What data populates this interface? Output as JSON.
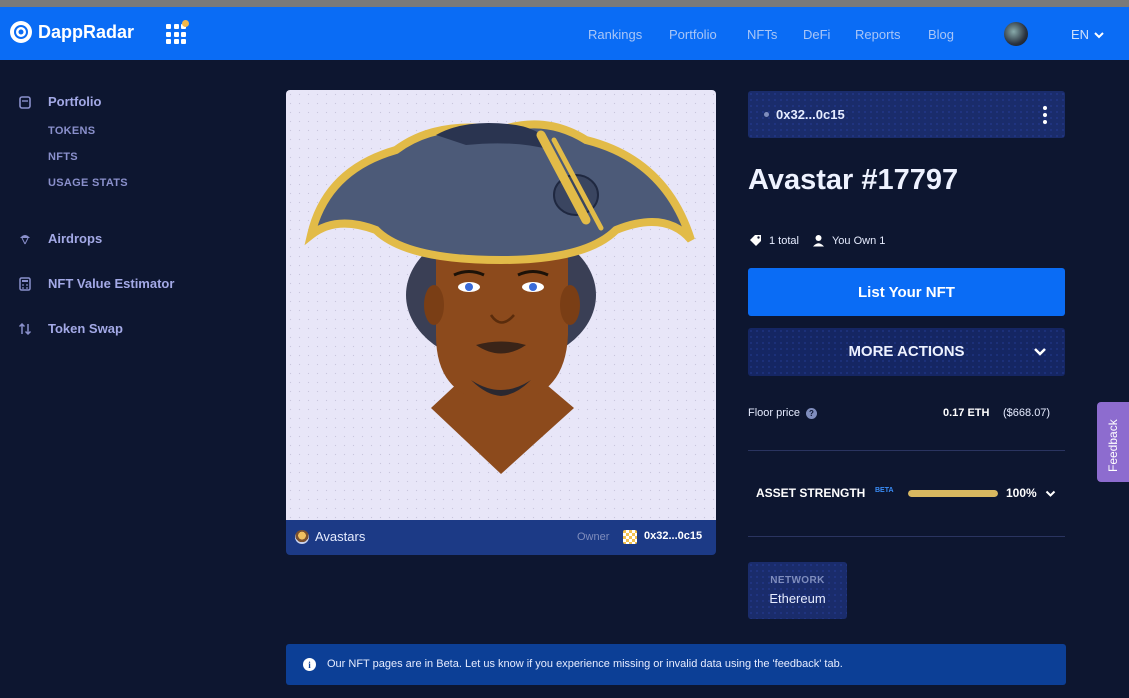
{
  "brand": {
    "name": "DappRadar"
  },
  "nav": {
    "links": [
      "Rankings",
      "Portfolio",
      "NFTs",
      "DeFi",
      "Reports",
      "Blog"
    ],
    "language": "EN"
  },
  "sidebar": {
    "portfolio": "Portfolio",
    "portfolio_items": [
      "TOKENS",
      "NFTS",
      "USAGE STATS"
    ],
    "airdrops": "Airdrops",
    "estimator": "NFT Value Estimator",
    "swap": "Token Swap"
  },
  "nft": {
    "collection": "Avastars",
    "owner_label": "Owner",
    "owner_address": "0x32...0c15",
    "top_address": "0x32...0c15",
    "title": "Avastar #17797",
    "total": "1 total",
    "you_own": "You Own 1",
    "list_button": "List Your NFT",
    "more_actions": "MORE ACTIONS",
    "floor_label": "Floor price",
    "floor_eth": "0.17 ETH",
    "floor_usd": "($668.07)",
    "asset_strength_label": "ASSET STRENGTH",
    "beta": "BETA",
    "asset_strength_value": "100%",
    "asset_strength_fraction": 1.0,
    "network_label": "NETWORK",
    "network": "Ethereum"
  },
  "banner": {
    "text": "Our NFT pages are in Beta. Let us know if you experience missing or invalid data using the 'feedback' tab."
  },
  "feedback": "Feedback",
  "colors": {
    "accent": "#0a6cf5",
    "background": "#0d1630",
    "strength": "#d8b860"
  }
}
